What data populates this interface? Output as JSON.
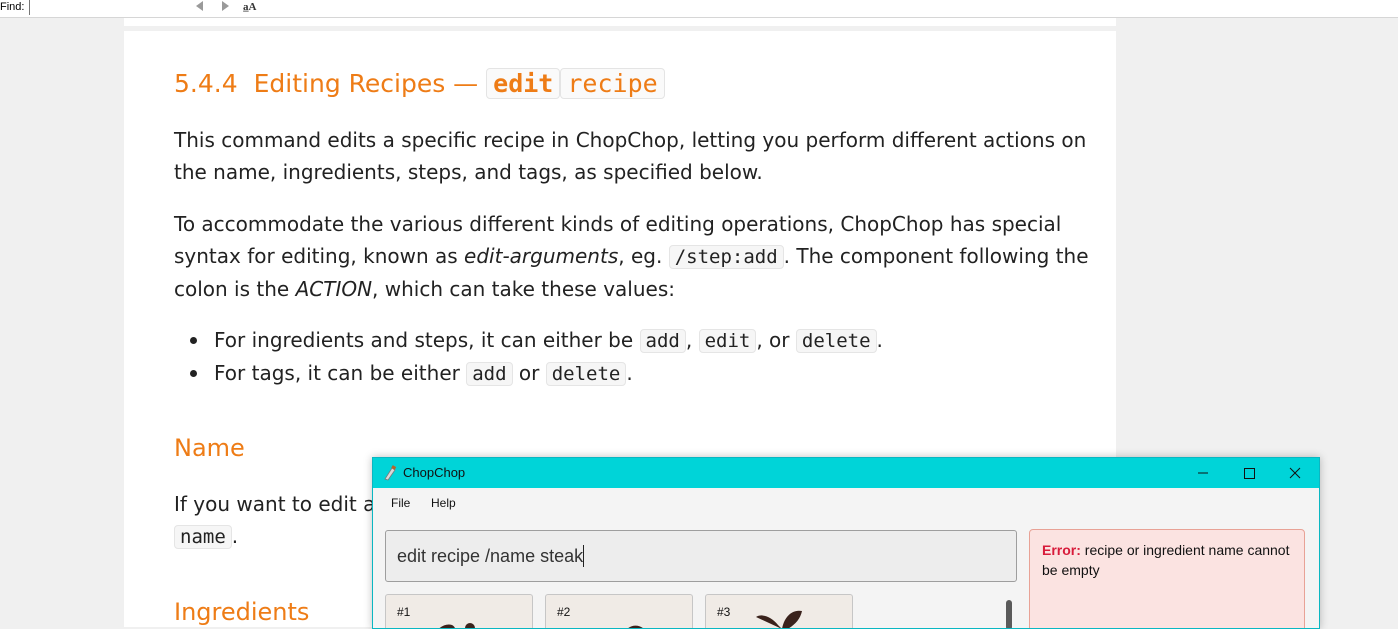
{
  "find_bar": {
    "label": "Find:",
    "match_case_glyph": "a̲A"
  },
  "doc": {
    "section_number": "5.4.4",
    "section_title": "Editing Recipes —",
    "section_code_1": "edit",
    "section_code_2": "recipe",
    "para1": "This command edits a specific recipe in ChopChop, letting you perform different actions on the name, ingredients, steps, and tags, as specified below.",
    "para2": {
      "part1": "To accommodate the various different kinds of editing operations, ChopChop has special syntax for editing, known as ",
      "em1": "edit-arguments",
      "part2": ", eg. ",
      "code": "/step:add",
      "part3": ". The component following the colon is the ",
      "em2": "ACTION",
      "part4": ", which can take these values:"
    },
    "bullet1": {
      "text1": "For ingredients and steps, it can either be ",
      "code1": "add",
      "text2": ", ",
      "code2": "edit",
      "text3": ", or ",
      "code3": "delete",
      "text4": "."
    },
    "bullet2": {
      "text1": "For tags, it can be either ",
      "code1": "add",
      "text2": " or ",
      "code2": "delete",
      "text3": "."
    },
    "heading_name": "Name",
    "para3_visible": "If you want to edit a r",
    "para3_code": "name",
    "para3_end": ".",
    "heading_ingredients": "Ingredients"
  },
  "window": {
    "title": "ChopChop",
    "menu": [
      "File",
      "Help"
    ],
    "command_text": "edit recipe /name steak",
    "error_label": "Error:",
    "error_message": " recipe or ingredient name cannot be empty",
    "cards": [
      "#1",
      "#2",
      "#3"
    ],
    "titlebar_color": "#00d4d8",
    "error_bg_color": "#fbe3e1"
  },
  "colors": {
    "heading_accent": "#ee7c16",
    "error_label": "#d81b3a"
  }
}
